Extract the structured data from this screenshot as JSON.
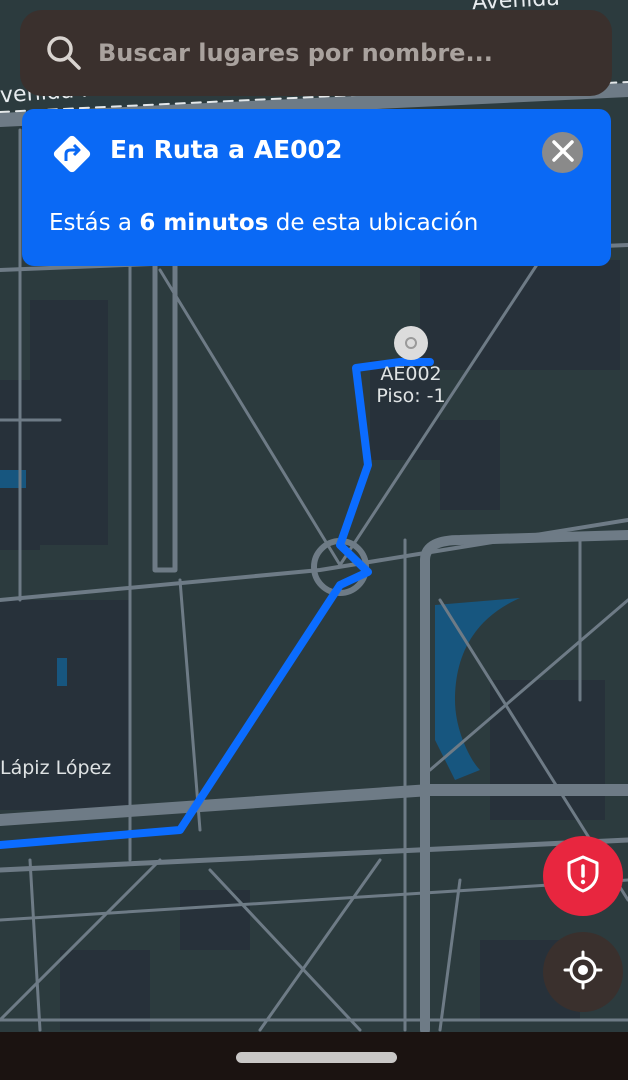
{
  "search": {
    "placeholder": "Buscar lugares por nombre..."
  },
  "route_card": {
    "title": "En Ruta a AE002",
    "desc_prefix": "Estás a ",
    "desc_time": "6 minutos",
    "desc_suffix": " de esta ubicación"
  },
  "map": {
    "destination_label": "AE002",
    "floor_label": "Piso: -1",
    "place_label": "Lápiz López",
    "street_top_right": "Avenida",
    "street_top_left": "venida M",
    "route_color": "#0b6cff",
    "road_color": "#6e7b86",
    "block_color": "#27313a",
    "water_color": "#17567f",
    "background_color": "#2b3a3d"
  },
  "buttons": {
    "close": "close-icon",
    "safety": "shield-alert-icon",
    "locate": "crosshair-icon",
    "search": "search-icon",
    "turn": "turn-right-icon",
    "safety_color": "#e8263f",
    "locate_color": "#3a302d"
  }
}
